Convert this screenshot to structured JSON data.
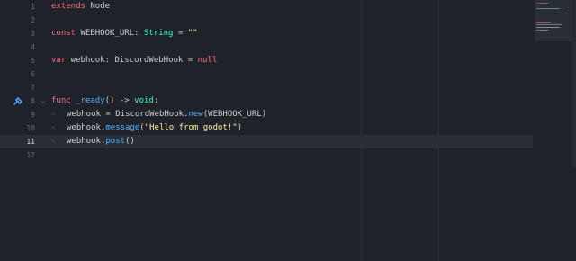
{
  "editor": {
    "lines": [
      {
        "number": "1",
        "segments": [
          {
            "text": "extends",
            "cls": "kw"
          },
          {
            "text": " Node",
            "cls": "plain"
          }
        ]
      },
      {
        "number": "2",
        "segments": []
      },
      {
        "number": "3",
        "segments": [
          {
            "text": "const",
            "cls": "kw"
          },
          {
            "text": " WEBHOOK_URL",
            "cls": "plain"
          },
          {
            "text": ":",
            "cls": "plain"
          },
          {
            "text": " String",
            "cls": "type"
          },
          {
            "text": " = ",
            "cls": "plain"
          },
          {
            "text": "\"\"",
            "cls": "str"
          }
        ]
      },
      {
        "number": "4",
        "segments": []
      },
      {
        "number": "5",
        "segments": [
          {
            "text": "var",
            "cls": "kw"
          },
          {
            "text": " webhook",
            "cls": "plain"
          },
          {
            "text": ":",
            "cls": "plain"
          },
          {
            "text": " DiscordWebHook",
            "cls": "plain"
          },
          {
            "text": " = ",
            "cls": "plain"
          },
          {
            "text": "null",
            "cls": "kw"
          }
        ]
      },
      {
        "number": "6",
        "segments": []
      },
      {
        "number": "7",
        "segments": []
      },
      {
        "number": "8",
        "segments": [
          {
            "text": "func",
            "cls": "kw"
          },
          {
            "text": " _ready",
            "cls": "fn"
          },
          {
            "text": "()",
            "cls": "plain"
          },
          {
            "text": " -> ",
            "cls": "plain"
          },
          {
            "text": "void",
            "cls": "type"
          },
          {
            "text": ":",
            "cls": "plain"
          }
        ]
      },
      {
        "number": "9",
        "segments": [
          {
            "text": "webhook",
            "cls": "plain"
          },
          {
            "text": " = ",
            "cls": "plain"
          },
          {
            "text": "DiscordWebHook",
            "cls": "plain"
          },
          {
            "text": ".",
            "cls": "plain"
          },
          {
            "text": "new",
            "cls": "fn"
          },
          {
            "text": "(WEBHOOK_URL)",
            "cls": "plain"
          }
        ]
      },
      {
        "number": "10",
        "segments": [
          {
            "text": "webhook",
            "cls": "plain"
          },
          {
            "text": ".",
            "cls": "plain"
          },
          {
            "text": "message",
            "cls": "fn"
          },
          {
            "text": "(",
            "cls": "plain"
          },
          {
            "text": "\"Hello from godot!\"",
            "cls": "str"
          },
          {
            "text": ")",
            "cls": "plain"
          }
        ]
      },
      {
        "number": "11",
        "segments": [
          {
            "text": "webhook",
            "cls": "plain"
          },
          {
            "text": ".",
            "cls": "plain"
          },
          {
            "text": "post",
            "cls": "fn"
          },
          {
            "text": "()",
            "cls": "plain"
          }
        ]
      },
      {
        "number": "12",
        "segments": []
      }
    ],
    "tab_marker": "»",
    "fold_arrow": "⌄",
    "icons": {
      "fold": "chevron-down-icon",
      "connected": "signal-connection-icon"
    },
    "colors": {
      "background": "#1f2229",
      "current_line": "#2a2e36",
      "keyword": "#ff7085",
      "type": "#42ffc2",
      "string": "#ffeda1",
      "function": "#57b3ff",
      "text": "#cdcfd3",
      "line_number": "#6a7079",
      "connection_icon": "#4aa3ff"
    }
  }
}
